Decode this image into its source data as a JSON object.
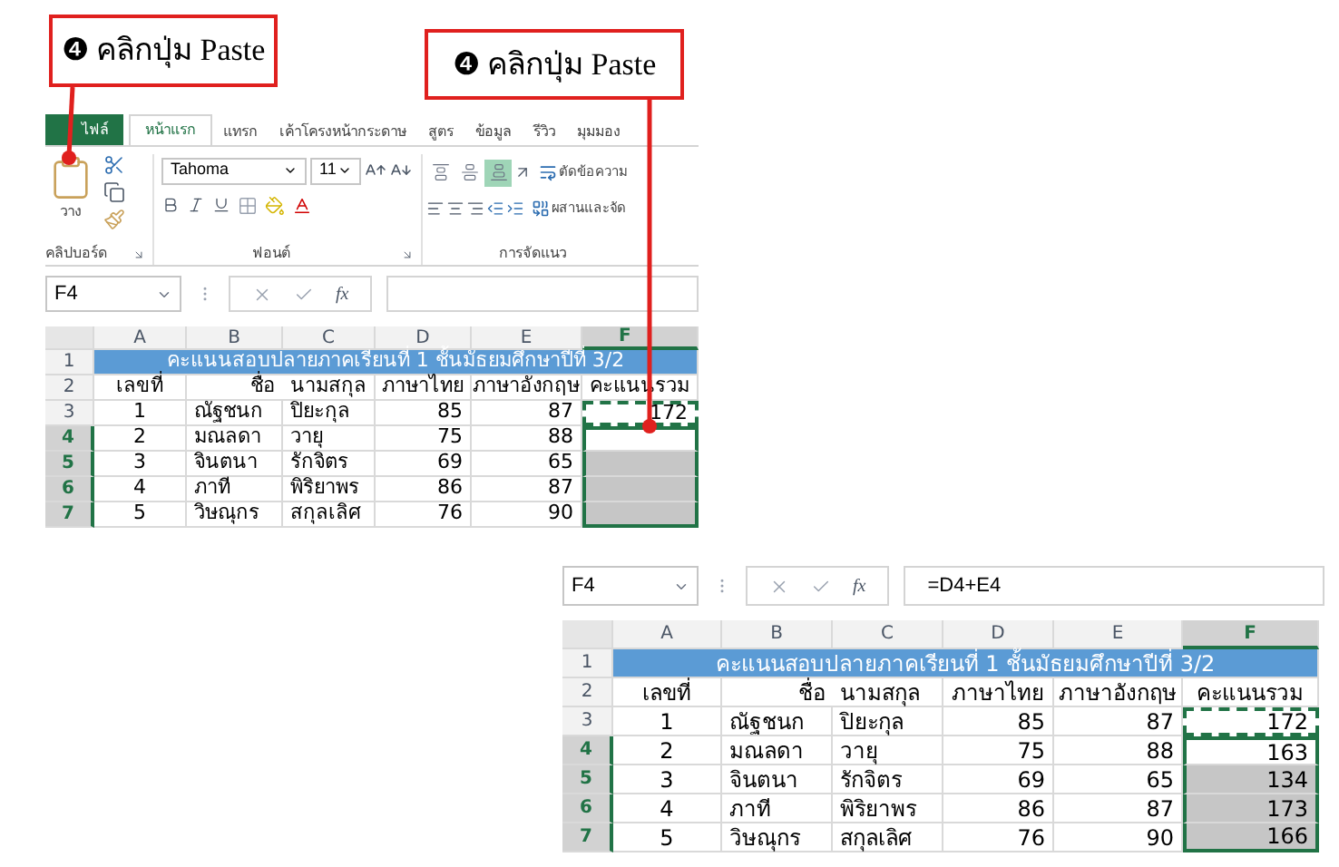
{
  "callouts": [
    {
      "marker": "❹",
      "text": "คลิกปุ่ม Paste"
    },
    {
      "marker": "❹",
      "text": "คลิกปุ่ม Paste"
    }
  ],
  "ribbon": {
    "tabs": [
      {
        "label": "ไฟล์",
        "kind": "file",
        "selected": false
      },
      {
        "label": "หน้าแรก",
        "kind": "tab",
        "selected": true
      },
      {
        "label": "แทรก",
        "kind": "tab",
        "selected": false
      },
      {
        "label": "เค้าโครงหน้ากระดาษ",
        "kind": "tab",
        "selected": false
      },
      {
        "label": "สูตร",
        "kind": "tab",
        "selected": false
      },
      {
        "label": "ข้อมูล",
        "kind": "tab",
        "selected": false
      },
      {
        "label": "รีวิว",
        "kind": "tab",
        "selected": false
      },
      {
        "label": "มุมมอง",
        "kind": "tab",
        "selected": false
      }
    ],
    "paste_label": "วาง",
    "font_name": "Tahoma",
    "font_size": "11",
    "vertical_align": [
      {
        "selected": false
      },
      {
        "selected": false
      },
      {
        "selected": true
      }
    ],
    "wrap_text": "ตัดข้อความ",
    "merge": "ผสานและจัด",
    "groups": [
      "คลิปบอร์ด",
      "ฟอนต์",
      "การจัดแนว"
    ]
  },
  "sheets": [
    {
      "name_box": "F4",
      "function_label": "fx",
      "columns": [
        {
          "label": "A",
          "selected": false
        },
        {
          "label": "B",
          "selected": false
        },
        {
          "label": "C",
          "selected": false
        },
        {
          "label": "D",
          "selected": false
        },
        {
          "label": "E",
          "selected": false
        },
        {
          "label": "F",
          "selected": true
        }
      ],
      "title": "คะแนนสอบปลายภาคเรียนที่ 1 ชั้นมัธยมศึกษาปีที่ 3/2",
      "headers": [
        "เลขที่",
        "ชื่อ",
        "นามสกุล",
        "ภาษาไทย",
        "ภาษาอังกฤษ",
        "คะแนนรวม"
      ],
      "rows": [
        {
          "header": "1",
          "selected": false
        },
        {
          "header": "2",
          "selected": false
        },
        {
          "header": "3",
          "selected": false,
          "cells": [
            "1",
            "ณัฐชนก",
            "ปิยะกุล",
            "85",
            "87",
            "172"
          ],
          "copied": true
        },
        {
          "header": "4",
          "selected": true,
          "cells": [
            "2",
            "มณลดา",
            "วายุ",
            "75",
            "88"
          ],
          "copied": false,
          "in_selection": true,
          "active": true
        },
        {
          "header": "5",
          "selected": true,
          "cells": [
            "3",
            "จินตนา",
            "รักจิตร",
            "69",
            "65"
          ],
          "copied": false,
          "in_selection": true,
          "active": false
        },
        {
          "header": "6",
          "selected": true,
          "cells": [
            "4",
            "ภาที",
            "พิริยาพร",
            "86",
            "87"
          ],
          "copied": false,
          "in_selection": true,
          "active": false
        },
        {
          "header": "7",
          "selected": true,
          "cells": [
            "5",
            "วิษณุกร",
            "สกุลเลิศ",
            "76",
            "90"
          ],
          "copied": false,
          "in_selection": true,
          "active": false
        }
      ]
    },
    {
      "name_box": "F4",
      "function_label": "fx",
      "formula": "=D4+E4",
      "columns": [
        {
          "label": "A",
          "selected": false
        },
        {
          "label": "B",
          "selected": false
        },
        {
          "label": "C",
          "selected": false
        },
        {
          "label": "D",
          "selected": false
        },
        {
          "label": "E",
          "selected": false
        },
        {
          "label": "F",
          "selected": true
        }
      ],
      "title": "คะแนนสอบปลายภาคเรียนที่ 1 ชั้นมัธยมศึกษาปีที่ 3/2",
      "headers": [
        "เลขที่",
        "ชื่อ",
        "นามสกุล",
        "ภาษาไทย",
        "ภาษาอังกฤษ",
        "คะแนนรวม"
      ],
      "rows": [
        {
          "header": "1",
          "selected": false
        },
        {
          "header": "2",
          "selected": false
        },
        {
          "header": "3",
          "selected": false,
          "cells": [
            "1",
            "ณัฐชนก",
            "ปิยะกุล",
            "85",
            "87",
            "172"
          ],
          "copied": true
        },
        {
          "header": "4",
          "selected": true,
          "cells": [
            "2",
            "มณลดา",
            "วายุ",
            "75",
            "88",
            "163"
          ],
          "copied": false,
          "in_selection": true,
          "active": true
        },
        {
          "header": "5",
          "selected": true,
          "cells": [
            "3",
            "จินตนา",
            "รักจิตร",
            "69",
            "65",
            "134"
          ],
          "copied": false,
          "in_selection": true,
          "active": false
        },
        {
          "header": "6",
          "selected": true,
          "cells": [
            "4",
            "ภาที",
            "พิริยาพร",
            "86",
            "87",
            "173"
          ],
          "copied": false,
          "in_selection": true,
          "active": false
        },
        {
          "header": "7",
          "selected": true,
          "cells": [
            "5",
            "วิษณุกร",
            "สกุลเลิศ",
            "76",
            "90",
            "166"
          ],
          "copied": false,
          "in_selection": true,
          "active": false
        }
      ]
    }
  ]
}
